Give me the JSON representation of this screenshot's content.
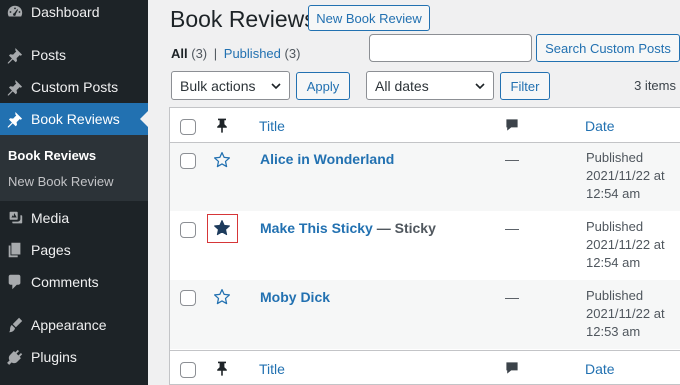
{
  "sidebar": {
    "items": [
      {
        "label": "Dashboard",
        "icon": "dashboard-icon"
      },
      {
        "label": "Posts",
        "icon": "pin-icon"
      },
      {
        "label": "Custom Posts",
        "icon": "pin-icon"
      },
      {
        "label": "Book Reviews",
        "icon": "pin-icon",
        "active": true
      },
      {
        "label": "Media",
        "icon": "media-icon"
      },
      {
        "label": "Pages",
        "icon": "pages-icon"
      },
      {
        "label": "Comments",
        "icon": "comments-icon"
      },
      {
        "label": "Appearance",
        "icon": "appearance-icon"
      },
      {
        "label": "Plugins",
        "icon": "plugins-icon"
      }
    ],
    "submenu": [
      "Book Reviews",
      "New Book Review"
    ]
  },
  "header": {
    "title": "Book Reviews",
    "add_new": "New Book Review"
  },
  "filters": {
    "all_label": "All",
    "all_count": "(3)",
    "separator": "|",
    "published_label": "Published",
    "published_count": "(3)"
  },
  "search": {
    "value": "",
    "button": "Search Custom Posts"
  },
  "toolbar": {
    "bulk_actions": "Bulk actions",
    "apply": "Apply",
    "dates": "All dates",
    "filter": "Filter",
    "items_count": "3 items"
  },
  "table": {
    "columns": {
      "title": "Title",
      "date": "Date"
    },
    "rows": [
      {
        "title": "Alice in Wonderland",
        "sticky": false,
        "state": "",
        "comments": "—",
        "status": "Published",
        "date": "2021/11/22 at",
        "time": "12:54 am"
      },
      {
        "title": "Make This Sticky",
        "sticky": true,
        "state": " — Sticky",
        "comments": "—",
        "status": "Published",
        "date": "2021/11/22 at",
        "time": "12:54 am"
      },
      {
        "title": "Moby Dick",
        "sticky": false,
        "state": "",
        "comments": "—",
        "status": "Published",
        "date": "2021/11/22 at",
        "time": "12:53 am"
      }
    ]
  },
  "colors": {
    "accent": "#2271b1",
    "sidebar_bg": "#1d2327",
    "highlight_box": "#d63638",
    "star_filled": "#1d3b5c"
  }
}
